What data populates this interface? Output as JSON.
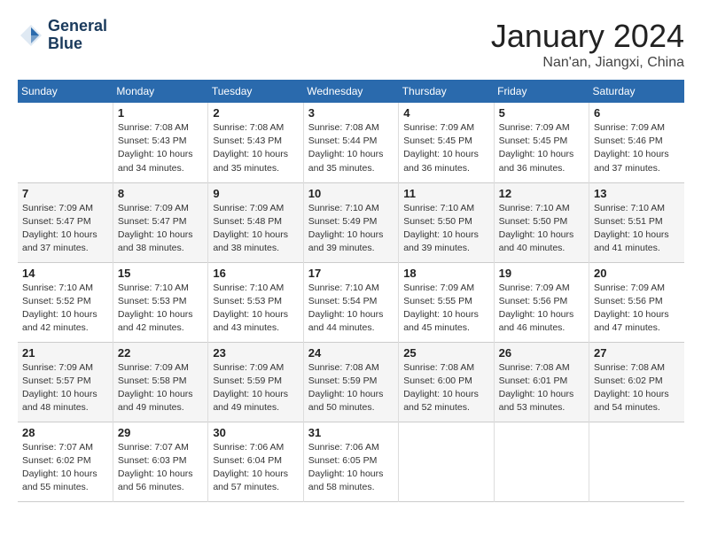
{
  "header": {
    "logo_line1": "General",
    "logo_line2": "Blue",
    "month_year": "January 2024",
    "location": "Nan'an, Jiangxi, China"
  },
  "columns": [
    "Sunday",
    "Monday",
    "Tuesday",
    "Wednesday",
    "Thursday",
    "Friday",
    "Saturday"
  ],
  "weeks": [
    [
      {
        "day": "",
        "info": ""
      },
      {
        "day": "1",
        "info": "Sunrise: 7:08 AM\nSunset: 5:43 PM\nDaylight: 10 hours\nand 34 minutes."
      },
      {
        "day": "2",
        "info": "Sunrise: 7:08 AM\nSunset: 5:43 PM\nDaylight: 10 hours\nand 35 minutes."
      },
      {
        "day": "3",
        "info": "Sunrise: 7:08 AM\nSunset: 5:44 PM\nDaylight: 10 hours\nand 35 minutes."
      },
      {
        "day": "4",
        "info": "Sunrise: 7:09 AM\nSunset: 5:45 PM\nDaylight: 10 hours\nand 36 minutes."
      },
      {
        "day": "5",
        "info": "Sunrise: 7:09 AM\nSunset: 5:45 PM\nDaylight: 10 hours\nand 36 minutes."
      },
      {
        "day": "6",
        "info": "Sunrise: 7:09 AM\nSunset: 5:46 PM\nDaylight: 10 hours\nand 37 minutes."
      }
    ],
    [
      {
        "day": "7",
        "info": "Sunrise: 7:09 AM\nSunset: 5:47 PM\nDaylight: 10 hours\nand 37 minutes."
      },
      {
        "day": "8",
        "info": "Sunrise: 7:09 AM\nSunset: 5:47 PM\nDaylight: 10 hours\nand 38 minutes."
      },
      {
        "day": "9",
        "info": "Sunrise: 7:09 AM\nSunset: 5:48 PM\nDaylight: 10 hours\nand 38 minutes."
      },
      {
        "day": "10",
        "info": "Sunrise: 7:10 AM\nSunset: 5:49 PM\nDaylight: 10 hours\nand 39 minutes."
      },
      {
        "day": "11",
        "info": "Sunrise: 7:10 AM\nSunset: 5:50 PM\nDaylight: 10 hours\nand 39 minutes."
      },
      {
        "day": "12",
        "info": "Sunrise: 7:10 AM\nSunset: 5:50 PM\nDaylight: 10 hours\nand 40 minutes."
      },
      {
        "day": "13",
        "info": "Sunrise: 7:10 AM\nSunset: 5:51 PM\nDaylight: 10 hours\nand 41 minutes."
      }
    ],
    [
      {
        "day": "14",
        "info": "Sunrise: 7:10 AM\nSunset: 5:52 PM\nDaylight: 10 hours\nand 42 minutes."
      },
      {
        "day": "15",
        "info": "Sunrise: 7:10 AM\nSunset: 5:53 PM\nDaylight: 10 hours\nand 42 minutes."
      },
      {
        "day": "16",
        "info": "Sunrise: 7:10 AM\nSunset: 5:53 PM\nDaylight: 10 hours\nand 43 minutes."
      },
      {
        "day": "17",
        "info": "Sunrise: 7:10 AM\nSunset: 5:54 PM\nDaylight: 10 hours\nand 44 minutes."
      },
      {
        "day": "18",
        "info": "Sunrise: 7:09 AM\nSunset: 5:55 PM\nDaylight: 10 hours\nand 45 minutes."
      },
      {
        "day": "19",
        "info": "Sunrise: 7:09 AM\nSunset: 5:56 PM\nDaylight: 10 hours\nand 46 minutes."
      },
      {
        "day": "20",
        "info": "Sunrise: 7:09 AM\nSunset: 5:56 PM\nDaylight: 10 hours\nand 47 minutes."
      }
    ],
    [
      {
        "day": "21",
        "info": "Sunrise: 7:09 AM\nSunset: 5:57 PM\nDaylight: 10 hours\nand 48 minutes."
      },
      {
        "day": "22",
        "info": "Sunrise: 7:09 AM\nSunset: 5:58 PM\nDaylight: 10 hours\nand 49 minutes."
      },
      {
        "day": "23",
        "info": "Sunrise: 7:09 AM\nSunset: 5:59 PM\nDaylight: 10 hours\nand 49 minutes."
      },
      {
        "day": "24",
        "info": "Sunrise: 7:08 AM\nSunset: 5:59 PM\nDaylight: 10 hours\nand 50 minutes."
      },
      {
        "day": "25",
        "info": "Sunrise: 7:08 AM\nSunset: 6:00 PM\nDaylight: 10 hours\nand 52 minutes."
      },
      {
        "day": "26",
        "info": "Sunrise: 7:08 AM\nSunset: 6:01 PM\nDaylight: 10 hours\nand 53 minutes."
      },
      {
        "day": "27",
        "info": "Sunrise: 7:08 AM\nSunset: 6:02 PM\nDaylight: 10 hours\nand 54 minutes."
      }
    ],
    [
      {
        "day": "28",
        "info": "Sunrise: 7:07 AM\nSunset: 6:02 PM\nDaylight: 10 hours\nand 55 minutes."
      },
      {
        "day": "29",
        "info": "Sunrise: 7:07 AM\nSunset: 6:03 PM\nDaylight: 10 hours\nand 56 minutes."
      },
      {
        "day": "30",
        "info": "Sunrise: 7:06 AM\nSunset: 6:04 PM\nDaylight: 10 hours\nand 57 minutes."
      },
      {
        "day": "31",
        "info": "Sunrise: 7:06 AM\nSunset: 6:05 PM\nDaylight: 10 hours\nand 58 minutes."
      },
      {
        "day": "",
        "info": ""
      },
      {
        "day": "",
        "info": ""
      },
      {
        "day": "",
        "info": ""
      }
    ]
  ]
}
